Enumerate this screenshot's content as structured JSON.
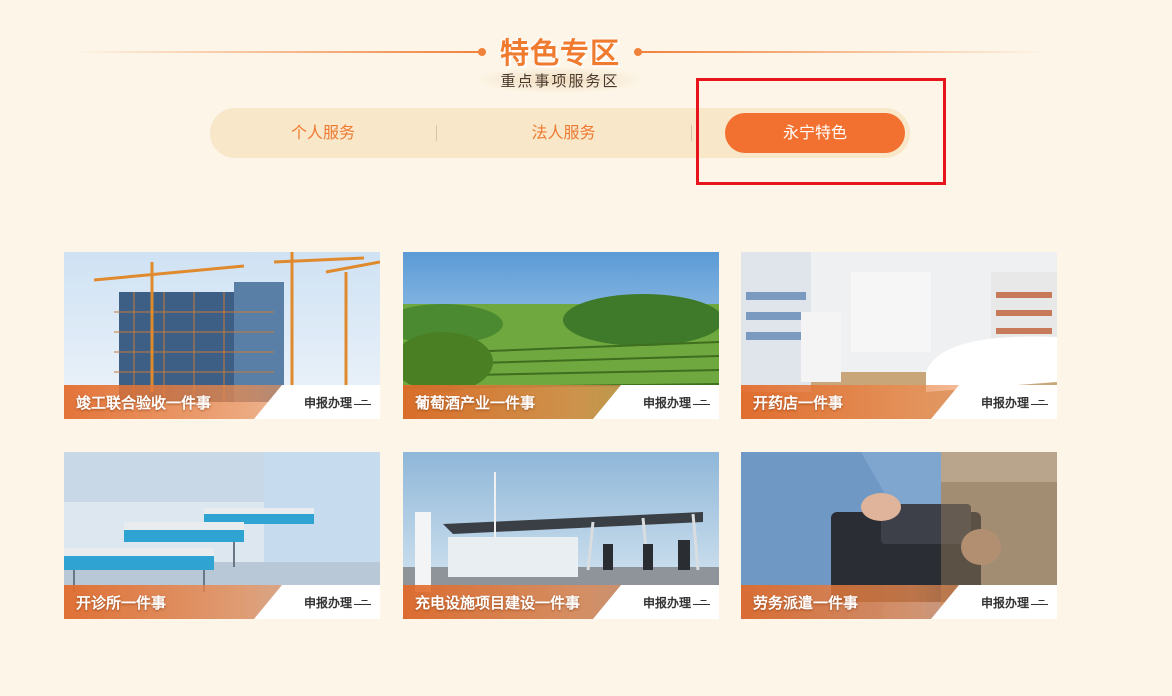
{
  "section": {
    "title": "特色专区",
    "subtitle": "重点事项服务区"
  },
  "tabs": [
    {
      "label": "个人服务",
      "active": false
    },
    {
      "label": "法人服务",
      "active": false
    },
    {
      "label": "永宁特色",
      "active": true
    }
  ],
  "cards": [
    {
      "title": "竣工联合验收一件事",
      "action": "申报办理",
      "image": "construction-site-illustration"
    },
    {
      "title": "葡萄酒产业一件事",
      "action": "申报办理",
      "image": "vineyard-landscape-illustration"
    },
    {
      "title": "开药店一件事",
      "action": "申报办理",
      "image": "pharmacy-interior-illustration"
    },
    {
      "title": "开诊所一件事",
      "action": "申报办理",
      "image": "hospital-ward-illustration"
    },
    {
      "title": "充电设施项目建设一件事",
      "action": "申报办理",
      "image": "ev-charging-station-illustration"
    },
    {
      "title": "劳务派遣一件事",
      "action": "申报办理",
      "image": "worker-with-bag-illustration"
    }
  ],
  "colors": {
    "accent": "#f37130",
    "page_bg": "#fdf6e8",
    "tab_bar_bg": "#f8e7c8",
    "highlight_box": "#e8141b"
  }
}
